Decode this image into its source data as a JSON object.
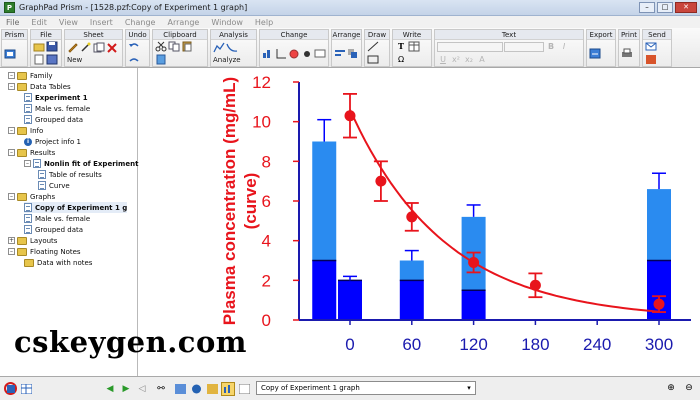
{
  "window": {
    "title": "GraphPad Prism - [1528.pzf:Copy of Experiment 1 graph]",
    "minimize": "–",
    "maximize": "□",
    "close": "✕",
    "app_icon": "P"
  },
  "menu": [
    "File",
    "Edit",
    "View",
    "Insert",
    "Change",
    "Arrange",
    "Window",
    "Help"
  ],
  "toolbar": {
    "groups": [
      "Prism",
      "File",
      "Sheet",
      "Undo",
      "Clipboard",
      "Analysis",
      "Change",
      "Arrange",
      "Draw",
      "Write",
      "Text",
      "Export",
      "Print",
      "Send"
    ],
    "new_label": "New",
    "analyze_label": "Analyze"
  },
  "tree": {
    "family": "Family",
    "data_tables": "Data Tables",
    "experiment1": "Experiment 1",
    "male_female": "Male vs. female",
    "grouped": "Grouped data",
    "info": "Info",
    "project_info": "Project info 1",
    "results": "Results",
    "nonlin": "Nonlin fit of Experiment",
    "table_results": "Table of results",
    "curve": "Curve",
    "graphs": "Graphs",
    "copy_exp": "Copy of Experiment 1 g",
    "g_male_female": "Male vs. female",
    "g_grouped": "Grouped data",
    "layouts": "Layouts",
    "floating_notes": "Floating Notes",
    "data_with_notes": "Data with notes"
  },
  "watermark": "cskeygen.com",
  "status": {
    "sheet": "Copy of Experiment 1 graph",
    "dropdown_arrow": "▾"
  },
  "colors": {
    "accent_red": "#e8141c",
    "bar_dark": "#0000ff",
    "bar_light": "#2a8bf0",
    "axis_blue": "#1a1aae"
  },
  "chart_data": {
    "type": "bar",
    "ylabel": "Plasma concentration (mg/mL) (curve)",
    "ylim": [
      0,
      12
    ],
    "y_ticks": [
      0,
      2,
      4,
      6,
      8,
      10,
      12
    ],
    "x_ticks": [
      0,
      60,
      120,
      180,
      240,
      300
    ],
    "bars": [
      {
        "x": -25,
        "lower": 3.0,
        "upper": 9.0,
        "error": 1.1
      },
      {
        "x": 0,
        "lower": 2.0,
        "upper": 2.0,
        "error": 0.2
      },
      {
        "x": 60,
        "lower": 2.0,
        "upper": 3.0,
        "error": 0.5
      },
      {
        "x": 120,
        "lower": 1.5,
        "upper": 5.2,
        "error": 0.6
      },
      {
        "x": 300,
        "lower": 3.0,
        "upper": 6.6,
        "error": 0.8
      }
    ],
    "points": [
      {
        "x": 0,
        "y": 10.3,
        "err": 1.1
      },
      {
        "x": 30,
        "y": 7.0,
        "err": 1.0
      },
      {
        "x": 60,
        "y": 5.2,
        "err": 0.7
      },
      {
        "x": 120,
        "y": 2.9,
        "err": 0.5
      },
      {
        "x": 180,
        "y": 1.75,
        "err": 0.6
      },
      {
        "x": 300,
        "y": 0.8,
        "err": 0.4
      }
    ],
    "curve": {
      "a": 10.6,
      "k": 0.0108,
      "x_start": 0,
      "x_end": 300
    }
  }
}
